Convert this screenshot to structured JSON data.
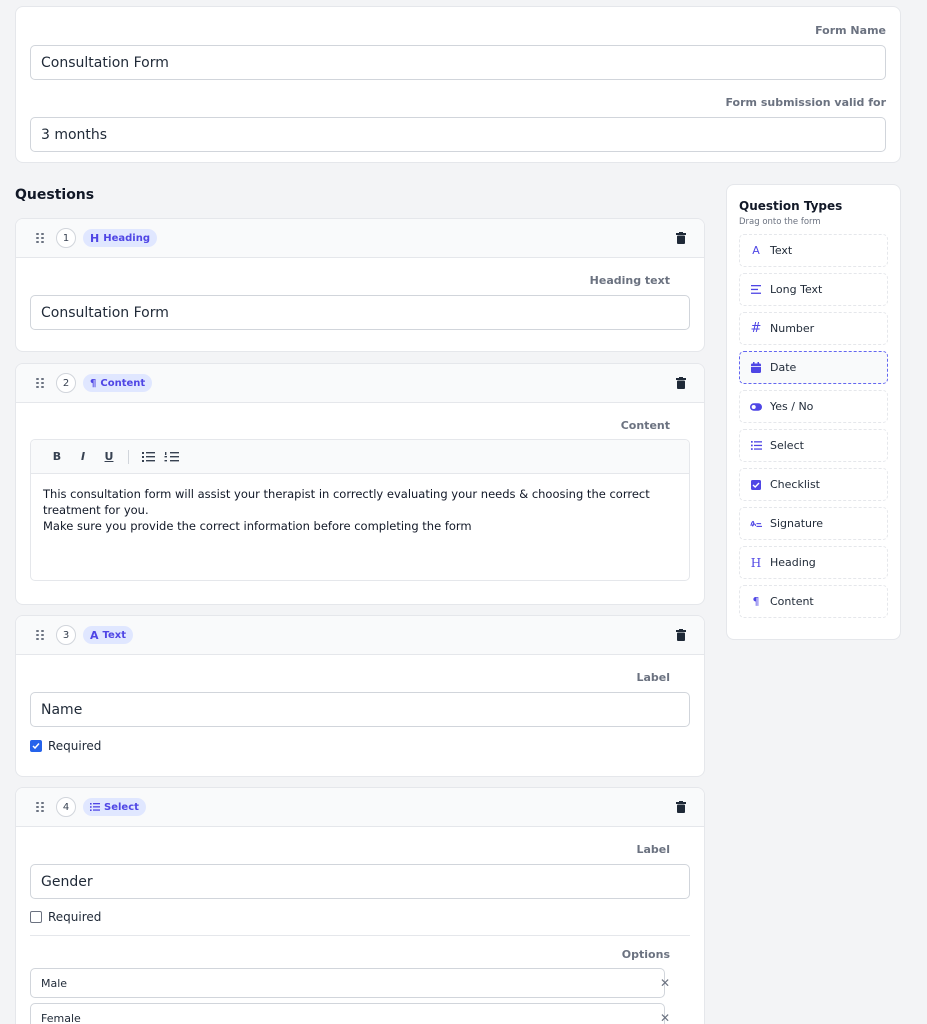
{
  "form": {
    "name_label": "Form Name",
    "name_value": "Consultation Form",
    "validity_label": "Form submission valid for",
    "validity_value": "3 months"
  },
  "questions_title": "Questions",
  "questions": [
    {
      "number": "1",
      "type": "Heading",
      "field_label": "Heading text",
      "value": "Consultation Form"
    },
    {
      "number": "2",
      "type": "Content",
      "field_label": "Content",
      "toolbar": {
        "bold": "B",
        "italic": "I",
        "underline": "U"
      },
      "text_line1": "This consultation form will assist your therapist in correctly evaluating your needs & choosing the correct",
      "text_line2": "treatment for you.",
      "text_line3": "Make sure you provide the correct information before completing the form"
    },
    {
      "number": "3",
      "type": "Text",
      "field_label": "Label",
      "value": "Name",
      "required_label": "Required",
      "required": true
    },
    {
      "number": "4",
      "type": "Select",
      "field_label": "Label",
      "value": "Gender",
      "required_label": "Required",
      "required": false,
      "options_label": "Options",
      "options": [
        "Male",
        "Female"
      ]
    }
  ],
  "sidebar": {
    "title": "Question Types",
    "subtitle": "Drag onto the form",
    "items": [
      {
        "label": "Text",
        "icon": "text-type-icon"
      },
      {
        "label": "Long Text",
        "icon": "long-text-icon"
      },
      {
        "label": "Number",
        "icon": "hash-icon"
      },
      {
        "label": "Date",
        "icon": "calendar-icon"
      },
      {
        "label": "Yes / No",
        "icon": "toggle-icon"
      },
      {
        "label": "Select",
        "icon": "list-icon"
      },
      {
        "label": "Checklist",
        "icon": "checkbox-icon"
      },
      {
        "label": "Signature",
        "icon": "signature-icon"
      },
      {
        "label": "Heading",
        "icon": "heading-icon"
      },
      {
        "label": "Content",
        "icon": "paragraph-icon"
      }
    ]
  },
  "colors": {
    "accent": "#4f46e5",
    "badge_bg": "#e0e7ff",
    "checkbox": "#2563eb"
  }
}
